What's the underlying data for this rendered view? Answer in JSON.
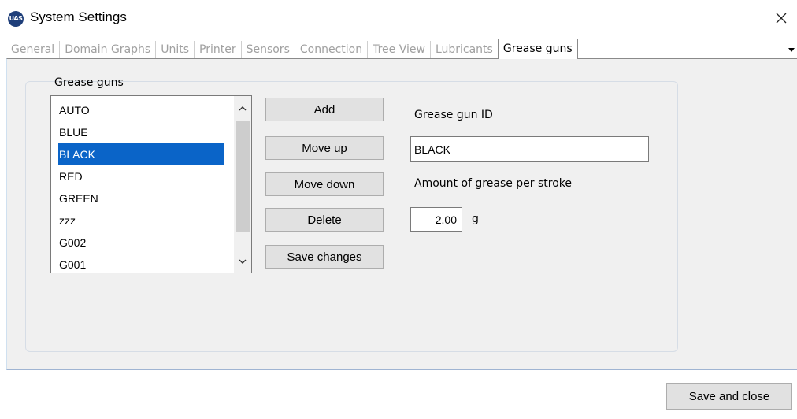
{
  "window": {
    "title": "System Settings",
    "logo_text": "UAS"
  },
  "tabs": [
    {
      "label": "General",
      "active": false
    },
    {
      "label": "Domain Graphs",
      "active": false
    },
    {
      "label": "Units",
      "active": false
    },
    {
      "label": "Printer",
      "active": false
    },
    {
      "label": "Sensors",
      "active": false
    },
    {
      "label": "Connection",
      "active": false
    },
    {
      "label": "Tree View",
      "active": false
    },
    {
      "label": "Lubricants",
      "active": false
    },
    {
      "label": "Grease guns",
      "active": true
    }
  ],
  "grease_guns": {
    "list_label": "Grease guns",
    "items": [
      "AUTO",
      "BLUE",
      "BLACK",
      "RED",
      "GREEN",
      "zzz",
      "G002",
      "G001"
    ],
    "selected": "BLACK",
    "buttons": {
      "add": "Add",
      "move_up": "Move up",
      "move_down": "Move down",
      "delete": "Delete",
      "save_changes": "Save changes"
    },
    "id_label": "Grease gun ID",
    "id_value": "BLACK",
    "amount_label": "Amount of grease per stroke",
    "amount_value": "2.00",
    "amount_unit": "g"
  },
  "footer": {
    "save_and_close": "Save and close"
  },
  "icons": {
    "close": "close-icon",
    "tab_scroll": "triangle-down-icon",
    "scroll_up": "chevron-up-icon",
    "scroll_down": "chevron-down-icon"
  },
  "colors": {
    "selection": "#0a64c8",
    "logo": "#1f3f7a"
  }
}
